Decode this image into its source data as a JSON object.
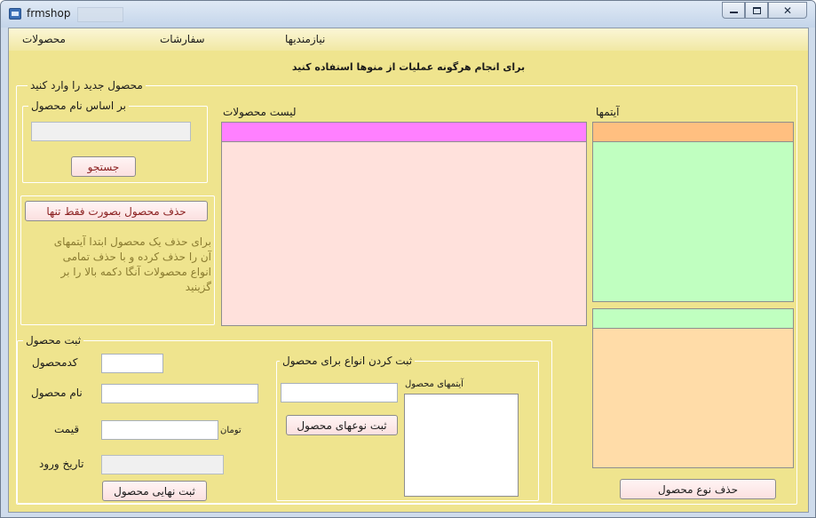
{
  "window": {
    "title": "frmshop",
    "minimize_icon": "minimize-icon",
    "maximize_icon": "maximize-icon",
    "close_icon": "close-icon"
  },
  "menu": {
    "products": "محصولات",
    "orders": "سفارشات",
    "needy": "نیازمندیها"
  },
  "instruction": "برای انجام هرگونه عملیات از منوها استفاده کنید",
  "new_product_group": {
    "legend": "محصول جدید را وارد کنید",
    "search_group": {
      "legend": "بر اساس نام  محصول",
      "search_value": "",
      "search_button": "جستجو"
    },
    "delete_group": {
      "delete_button": "حذف محصول بصورت فقط تنها",
      "note": "برای حذف یک محصول ابتدا آیتمهای آن را حذف کرده و با حذف تمامی انواع محصولات آنگا دکمه بالا را بر گزینید"
    },
    "products_list_label": "لیست محصولات",
    "items_label": "آیتمها"
  },
  "register_group": {
    "legend": "ثبت محصول",
    "code_label": "کدمحصول",
    "code_value": "",
    "name_label": "نام محصول",
    "name_value": "",
    "price_label": "قیمت",
    "price_value": "",
    "currency_label": "تومان",
    "date_label": "تاریخ ورود",
    "date_value": "",
    "final_button": "ثبت نهایی محصول"
  },
  "types_group": {
    "legend": "ثبت کردن انواع برای محصول",
    "type_value": "",
    "items_label": "آیتمهای محصول",
    "register_types_button": "ثبت نوعهای محصول"
  },
  "delete_type_button": "حذف نوع  محصول",
  "colors": {
    "form_background": "#efe48e",
    "products_grid_header": "#ff80ff",
    "products_grid_body": "#ffe1dc",
    "items_grid_header": "#ffbf80",
    "items_grid_body": "#c0ffc0",
    "types_grid_header": "#c0ffc0",
    "types_grid_body": "#ffdca8"
  }
}
